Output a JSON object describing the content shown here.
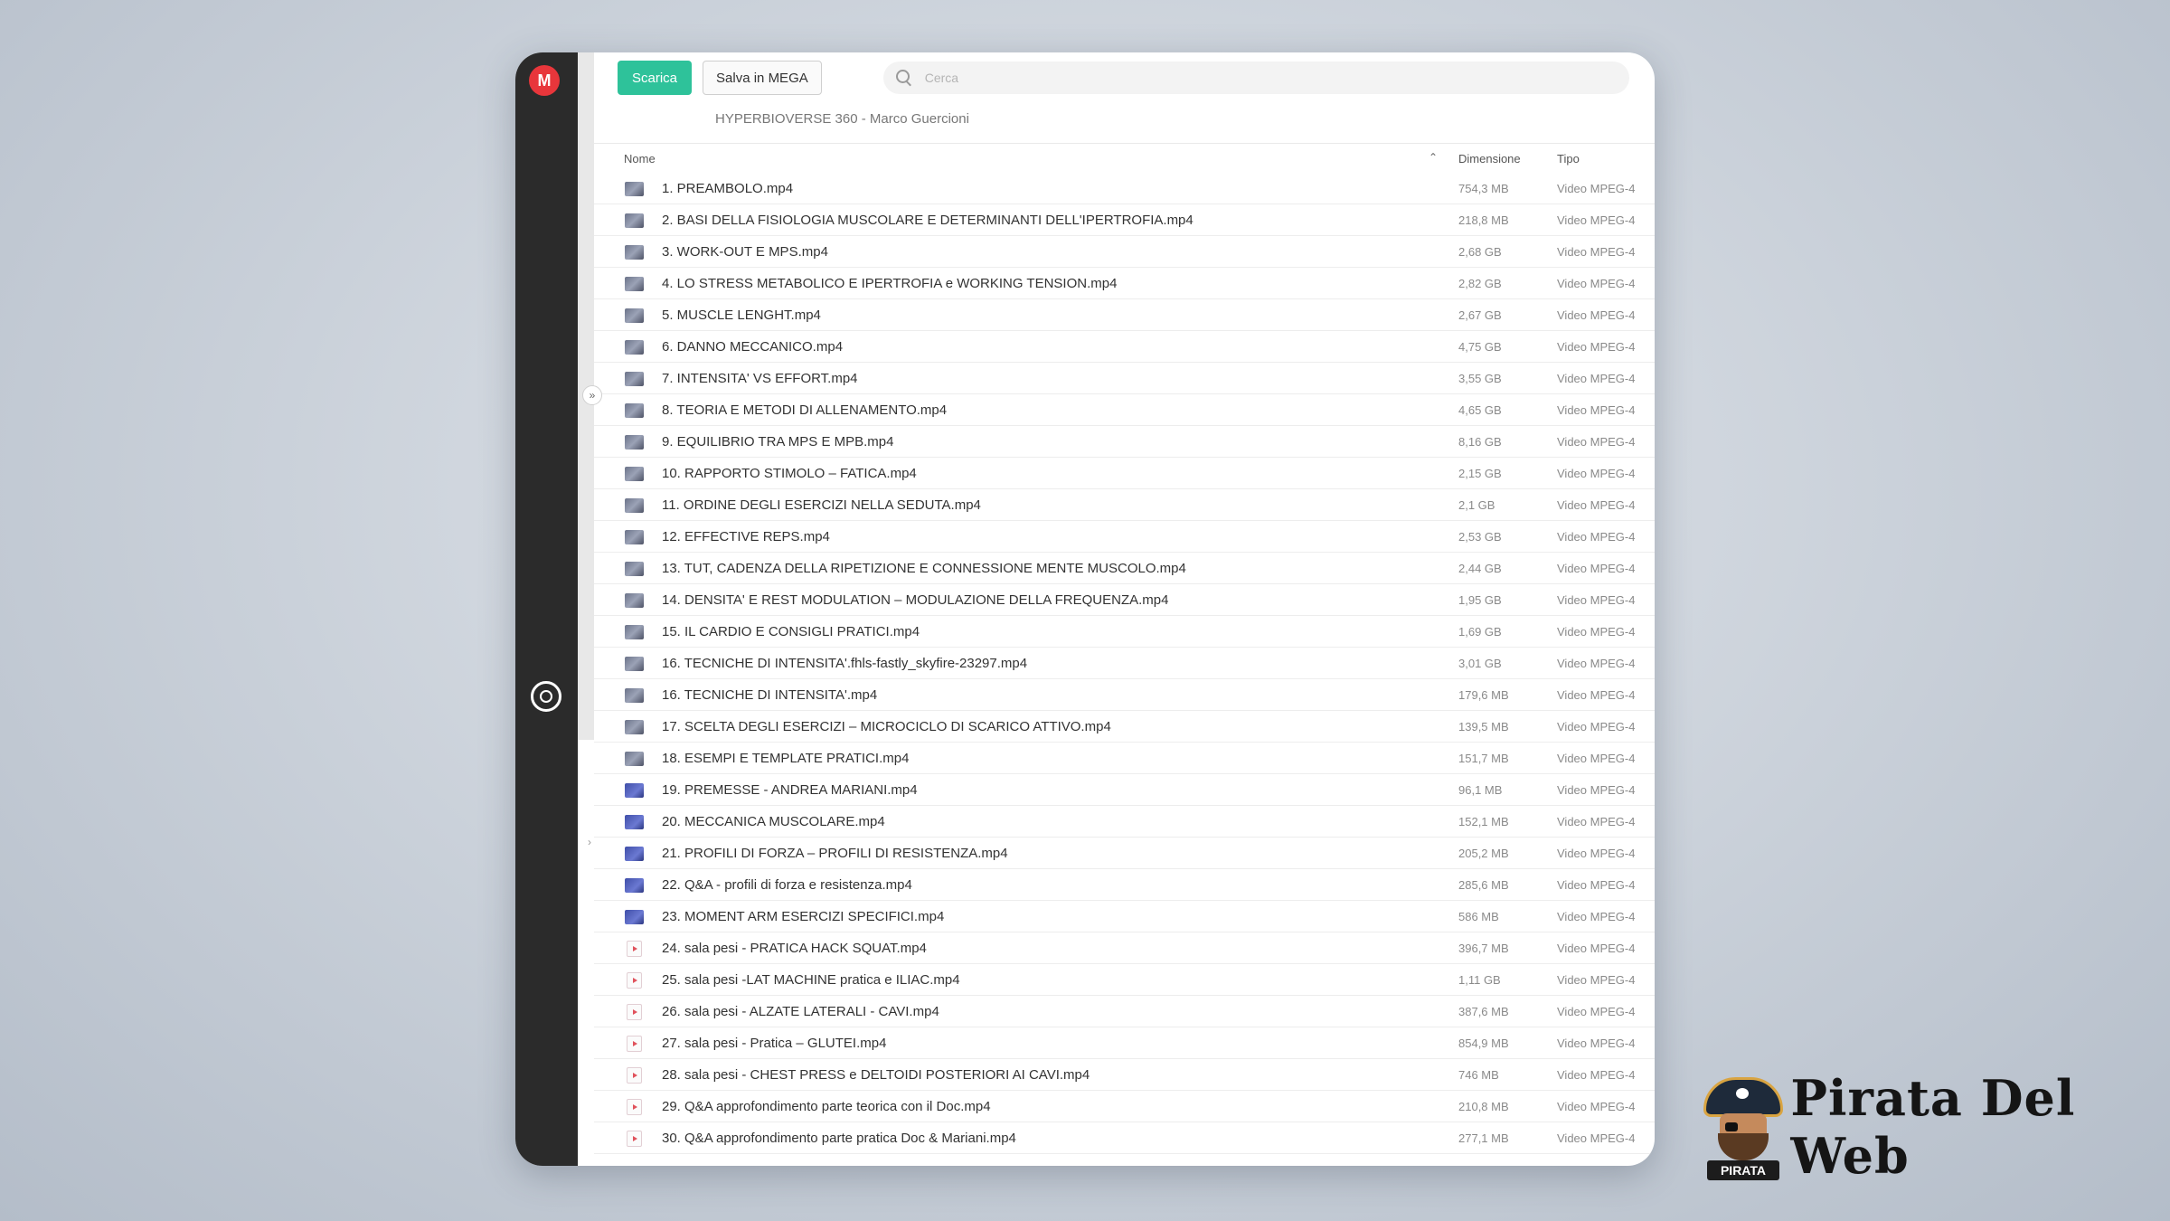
{
  "toolbar": {
    "download_label": "Scarica",
    "save_label": "Salva in MEGA",
    "search_placeholder": "Cerca"
  },
  "breadcrumb": "HYPERBIOVERSE 360 - Marco Guercioni",
  "columns": {
    "name": "Nome",
    "size": "Dimensione",
    "type": "Tipo"
  },
  "files": [
    {
      "name": "1. PREAMBOLO.mp4",
      "size": "754,3 MB",
      "type": "Video MPEG-4",
      "thumb": "gray"
    },
    {
      "name": "2. BASI DELLA FISIOLOGIA MUSCOLARE E DETERMINANTI DELL'IPERTROFIA.mp4",
      "size": "218,8 MB",
      "type": "Video MPEG-4",
      "thumb": "gray"
    },
    {
      "name": "3. WORK-OUT E MPS.mp4",
      "size": "2,68 GB",
      "type": "Video MPEG-4",
      "thumb": "gray"
    },
    {
      "name": "4. LO STRESS METABOLICO E IPERTROFIA e WORKING TENSION.mp4",
      "size": "2,82 GB",
      "type": "Video MPEG-4",
      "thumb": "gray"
    },
    {
      "name": "5. MUSCLE LENGHT.mp4",
      "size": "2,67 GB",
      "type": "Video MPEG-4",
      "thumb": "gray"
    },
    {
      "name": "6. DANNO MECCANICO.mp4",
      "size": "4,75 GB",
      "type": "Video MPEG-4",
      "thumb": "gray"
    },
    {
      "name": "7. INTENSITA' VS EFFORT.mp4",
      "size": "3,55 GB",
      "type": "Video MPEG-4",
      "thumb": "gray"
    },
    {
      "name": "8. TEORIA E METODI DI ALLENAMENTO.mp4",
      "size": "4,65 GB",
      "type": "Video MPEG-4",
      "thumb": "gray"
    },
    {
      "name": "9. EQUILIBRIO TRA MPS E MPB.mp4",
      "size": "8,16 GB",
      "type": "Video MPEG-4",
      "thumb": "gray"
    },
    {
      "name": "10. RAPPORTO STIMOLO – FATICA.mp4",
      "size": "2,15 GB",
      "type": "Video MPEG-4",
      "thumb": "gray"
    },
    {
      "name": "11. ORDINE DEGLI ESERCIZI NELLA SEDUTA.mp4",
      "size": "2,1 GB",
      "type": "Video MPEG-4",
      "thumb": "gray"
    },
    {
      "name": "12. EFFECTIVE REPS.mp4",
      "size": "2,53 GB",
      "type": "Video MPEG-4",
      "thumb": "gray"
    },
    {
      "name": "13. TUT, CADENZA DELLA RIPETIZIONE E CONNESSIONE MENTE MUSCOLO.mp4",
      "size": "2,44 GB",
      "type": "Video MPEG-4",
      "thumb": "gray"
    },
    {
      "name": "14. DENSITA' E REST MODULATION – MODULAZIONE DELLA FREQUENZA.mp4",
      "size": "1,95 GB",
      "type": "Video MPEG-4",
      "thumb": "gray"
    },
    {
      "name": "15. IL CARDIO E CONSIGLI PRATICI.mp4",
      "size": "1,69 GB",
      "type": "Video MPEG-4",
      "thumb": "gray"
    },
    {
      "name": "16. TECNICHE DI INTENSITA'.fhls-fastly_skyfire-23297.mp4",
      "size": "3,01 GB",
      "type": "Video MPEG-4",
      "thumb": "gray"
    },
    {
      "name": "16. TECNICHE DI INTENSITA'.mp4",
      "size": "179,6 MB",
      "type": "Video MPEG-4",
      "thumb": "gray"
    },
    {
      "name": "17. SCELTA DEGLI ESERCIZI – MICROCICLO DI SCARICO ATTIVO.mp4",
      "size": "139,5 MB",
      "type": "Video MPEG-4",
      "thumb": "gray"
    },
    {
      "name": "18. ESEMPI E TEMPLATE PRATICI.mp4",
      "size": "151,7 MB",
      "type": "Video MPEG-4",
      "thumb": "gray"
    },
    {
      "name": "19. PREMESSE - ANDREA MARIANI.mp4",
      "size": "96,1 MB",
      "type": "Video MPEG-4",
      "thumb": "blue"
    },
    {
      "name": "20. MECCANICA MUSCOLARE.mp4",
      "size": "152,1 MB",
      "type": "Video MPEG-4",
      "thumb": "blue"
    },
    {
      "name": "21. PROFILI DI FORZA – PROFILI DI RESISTENZA.mp4",
      "size": "205,2 MB",
      "type": "Video MPEG-4",
      "thumb": "blue"
    },
    {
      "name": "22. Q&A - profili di forza e resistenza.mp4",
      "size": "285,6 MB",
      "type": "Video MPEG-4",
      "thumb": "blue"
    },
    {
      "name": "23. MOMENT ARM ESERCIZI SPECIFICI.mp4",
      "size": "586 MB",
      "type": "Video MPEG-4",
      "thumb": "blue"
    },
    {
      "name": "24. sala pesi - PRATICA HACK SQUAT.mp4",
      "size": "396,7 MB",
      "type": "Video MPEG-4",
      "thumb": "video"
    },
    {
      "name": "25. sala pesi -LAT MACHINE pratica e ILIAC.mp4",
      "size": "1,11 GB",
      "type": "Video MPEG-4",
      "thumb": "video"
    },
    {
      "name": "26. sala pesi - ALZATE LATERALI - CAVI.mp4",
      "size": "387,6 MB",
      "type": "Video MPEG-4",
      "thumb": "video"
    },
    {
      "name": "27. sala pesi - Pratica – GLUTEI.mp4",
      "size": "854,9 MB",
      "type": "Video MPEG-4",
      "thumb": "video"
    },
    {
      "name": "28. sala pesi - CHEST PRESS e DELTOIDI POSTERIORI AI CAVI.mp4",
      "size": "746 MB",
      "type": "Video MPEG-4",
      "thumb": "video"
    },
    {
      "name": "29. Q&A approfondimento parte teorica con il Doc.mp4",
      "size": "210,8 MB",
      "type": "Video MPEG-4",
      "thumb": "video"
    },
    {
      "name": "30. Q&A approfondimento parte pratica Doc & Mariani.mp4",
      "size": "277,1 MB",
      "type": "Video MPEG-4",
      "thumb": "video"
    }
  ],
  "branding": {
    "badge": "PIRATA",
    "name": "Pirata Del Web"
  },
  "colors": {
    "accent": "#2ec29a",
    "logo": "#e8363b",
    "sidebar": "#2b2b2b"
  },
  "icons": {
    "logo": "mega-logo-icon",
    "search": "search-icon",
    "sort": "chevron-up-icon",
    "expand": "double-chevron-right-icon"
  }
}
